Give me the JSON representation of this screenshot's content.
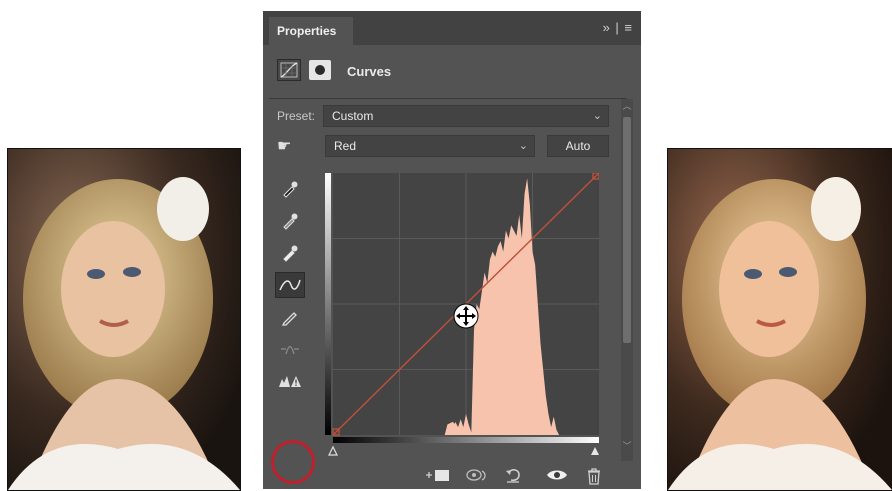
{
  "panel": {
    "tab_label": "Properties",
    "tab_menu": "»  |  ≡",
    "adjustment_title": "Curves",
    "preset_label": "Preset:",
    "preset_value": "Custom",
    "channel_value": "Red",
    "auto_label": "Auto"
  },
  "tools": [
    {
      "name": "black-point-eyedropper-icon"
    },
    {
      "name": "gray-point-eyedropper-icon"
    },
    {
      "name": "white-point-eyedropper-icon"
    },
    {
      "name": "curve-edit-points-icon"
    },
    {
      "name": "pencil-draw-icon"
    },
    {
      "name": "smooth-curve-icon"
    },
    {
      "name": "clipping-warning-icon"
    }
  ],
  "curve": {
    "channel_color": "#c0503a",
    "histogram_color": "#f7c3ac",
    "input_range": [
      0,
      255
    ],
    "output_range": [
      0,
      255
    ],
    "points": [
      [
        0,
        0
      ],
      [
        255,
        255
      ]
    ]
  },
  "footer_icons": [
    "clip-to-layer-icon",
    "view-previous-state-icon",
    "reset-icon",
    "toggle-visibility-icon",
    "delete-icon"
  ],
  "highlight_color": "#c0202c"
}
